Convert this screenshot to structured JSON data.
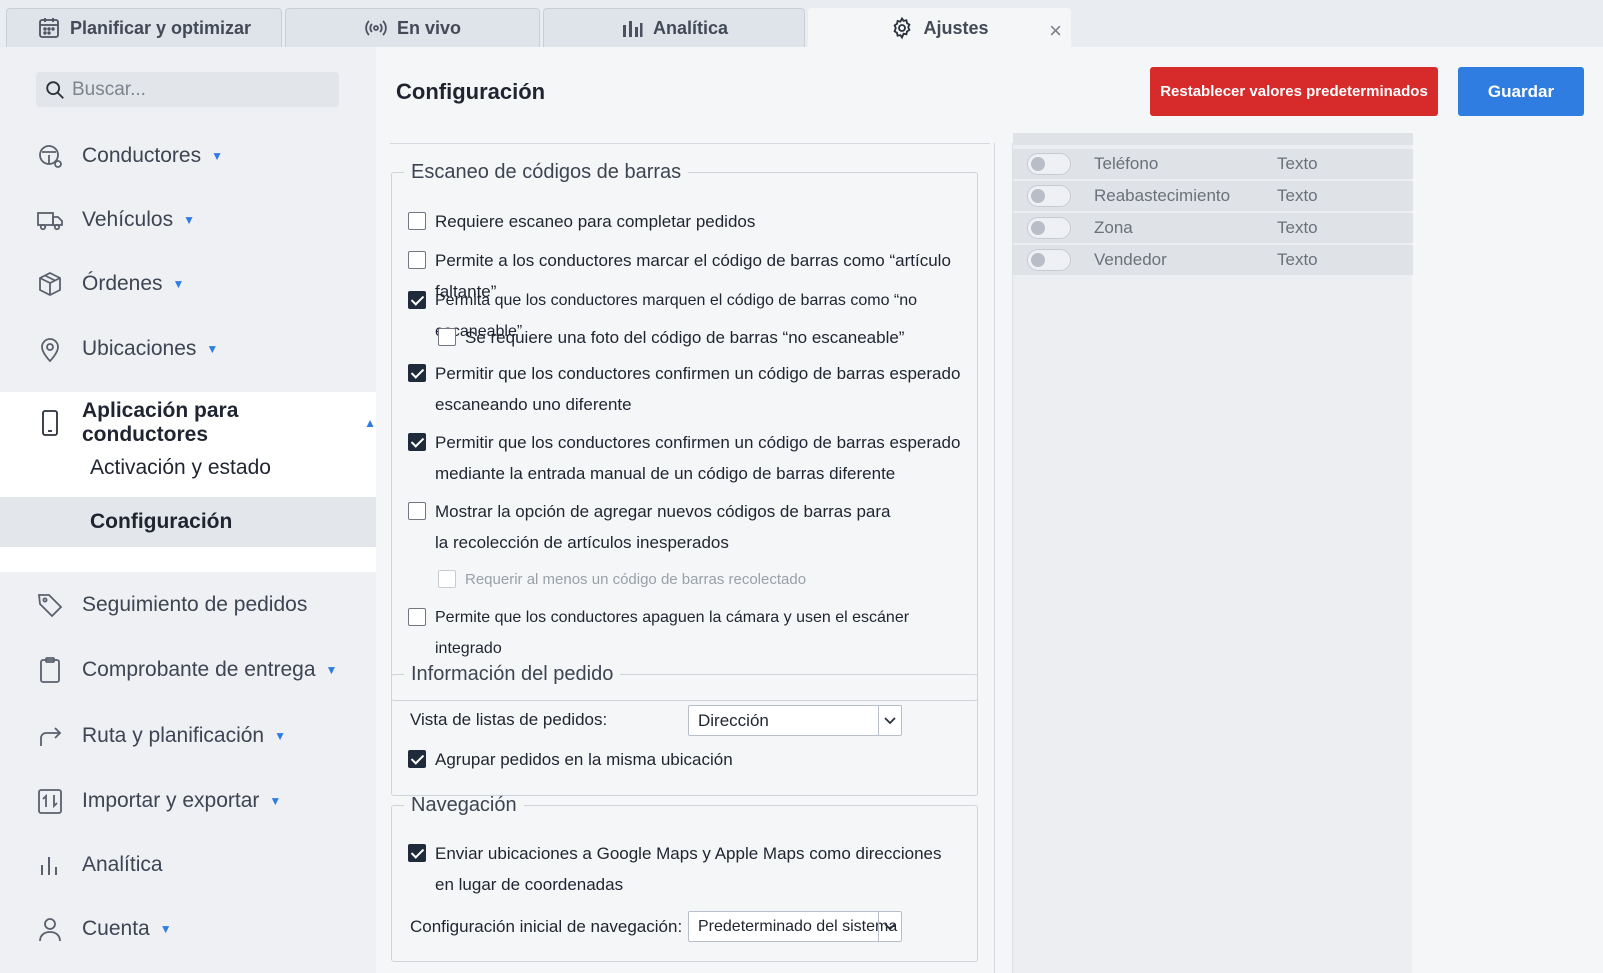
{
  "tabs": [
    {
      "label": "Planificar y optimizar",
      "icon": "calendar-icon"
    },
    {
      "label": "En vivo",
      "icon": "broadcast-icon"
    },
    {
      "label": "Analítica",
      "icon": "bar-chart-icon"
    },
    {
      "label": "Ajustes",
      "icon": "gear-icon"
    }
  ],
  "tab_close_glyph": "×",
  "sidebar": {
    "search_placeholder": "Buscar...",
    "items": [
      {
        "label": "Conductores",
        "icon": "steering-icon"
      },
      {
        "label": "Vehículos",
        "icon": "truck-icon"
      },
      {
        "label": "Órdenes",
        "icon": "box-icon"
      },
      {
        "label": "Ubicaciones",
        "icon": "map-pin-icon"
      },
      {
        "label": "Aplicación para conductores",
        "icon": "phone-icon"
      },
      {
        "label": "Seguimiento de pedidos",
        "icon": "tag-icon"
      },
      {
        "label": "Comprobante de entrega",
        "icon": "clipboard-icon"
      },
      {
        "label": "Ruta y planificación",
        "icon": "route-arrow-icon"
      },
      {
        "label": "Importar y exportar",
        "icon": "import-export-icon"
      },
      {
        "label": "Analítica",
        "icon": "analytics-icon"
      },
      {
        "label": "Cuenta",
        "icon": "user-icon"
      }
    ],
    "sub_items": [
      {
        "label": "Activación y estado"
      },
      {
        "label": "Configuración",
        "selected": true
      }
    ]
  },
  "main": {
    "title": "Configuración",
    "reset_label": "Restablecer valores predeterminados",
    "save_label": "Guardar",
    "colors": {
      "reset": "#d72b2b",
      "save": "#2f7de1"
    }
  },
  "barcode": {
    "legend": "Escaneo de códigos de barras",
    "options": [
      {
        "text": "Requiere escaneo para completar pedidos",
        "checked": false
      },
      {
        "text": "Permite a los conductores marcar el código de barras como “artículo faltante”",
        "checked": false
      },
      {
        "text": "Permita que los conductores marquen el código de barras como “no escaneable”",
        "checked": true
      },
      {
        "text": "Se requiere una foto del código de barras “no escaneable”",
        "checked": false
      },
      {
        "text": "Permitir que los conductores confirmen un código de barras esperado",
        "text2": "escaneando uno diferente",
        "checked": true
      },
      {
        "text": "Permitir que los conductores confirmen un código de barras esperado",
        "text2": "mediante la entrada manual de un código de barras diferente",
        "checked": true
      },
      {
        "text": "Mostrar la opción de agregar nuevos códigos de barras para",
        "text2": "la recolección de artículos inesperados",
        "checked": false
      },
      {
        "text": "Requerir al menos un código de barras recolectado",
        "checked": false,
        "disabled": true
      },
      {
        "text": "Permite que los conductores apaguen la cámara y usen el escáner integrado",
        "checked": false
      }
    ]
  },
  "order_info": {
    "legend": "Información del pedido",
    "list_view_label": "Vista de listas de pedidos:",
    "list_view_value": "Dirección",
    "group_label": "Agrupar pedidos en la misma ubicación",
    "group_checked": true
  },
  "navigation": {
    "legend": "Navegación",
    "send_label": "Enviar ubicaciones a Google Maps y Apple Maps como direcciones",
    "send_label2": "en lugar de coordenadas",
    "send_checked": true,
    "initial_label": "Configuración inicial de navegación:",
    "initial_value": "Predeterminado del sistema"
  },
  "custom_fields": [
    {
      "name": "Teléfono",
      "type": "Texto",
      "enabled": false
    },
    {
      "name": "Reabastecimiento",
      "type": "Texto",
      "enabled": false
    },
    {
      "name": "Zona",
      "type": "Texto",
      "enabled": false
    },
    {
      "name": "Vendedor",
      "type": "Texto",
      "enabled": false
    }
  ]
}
